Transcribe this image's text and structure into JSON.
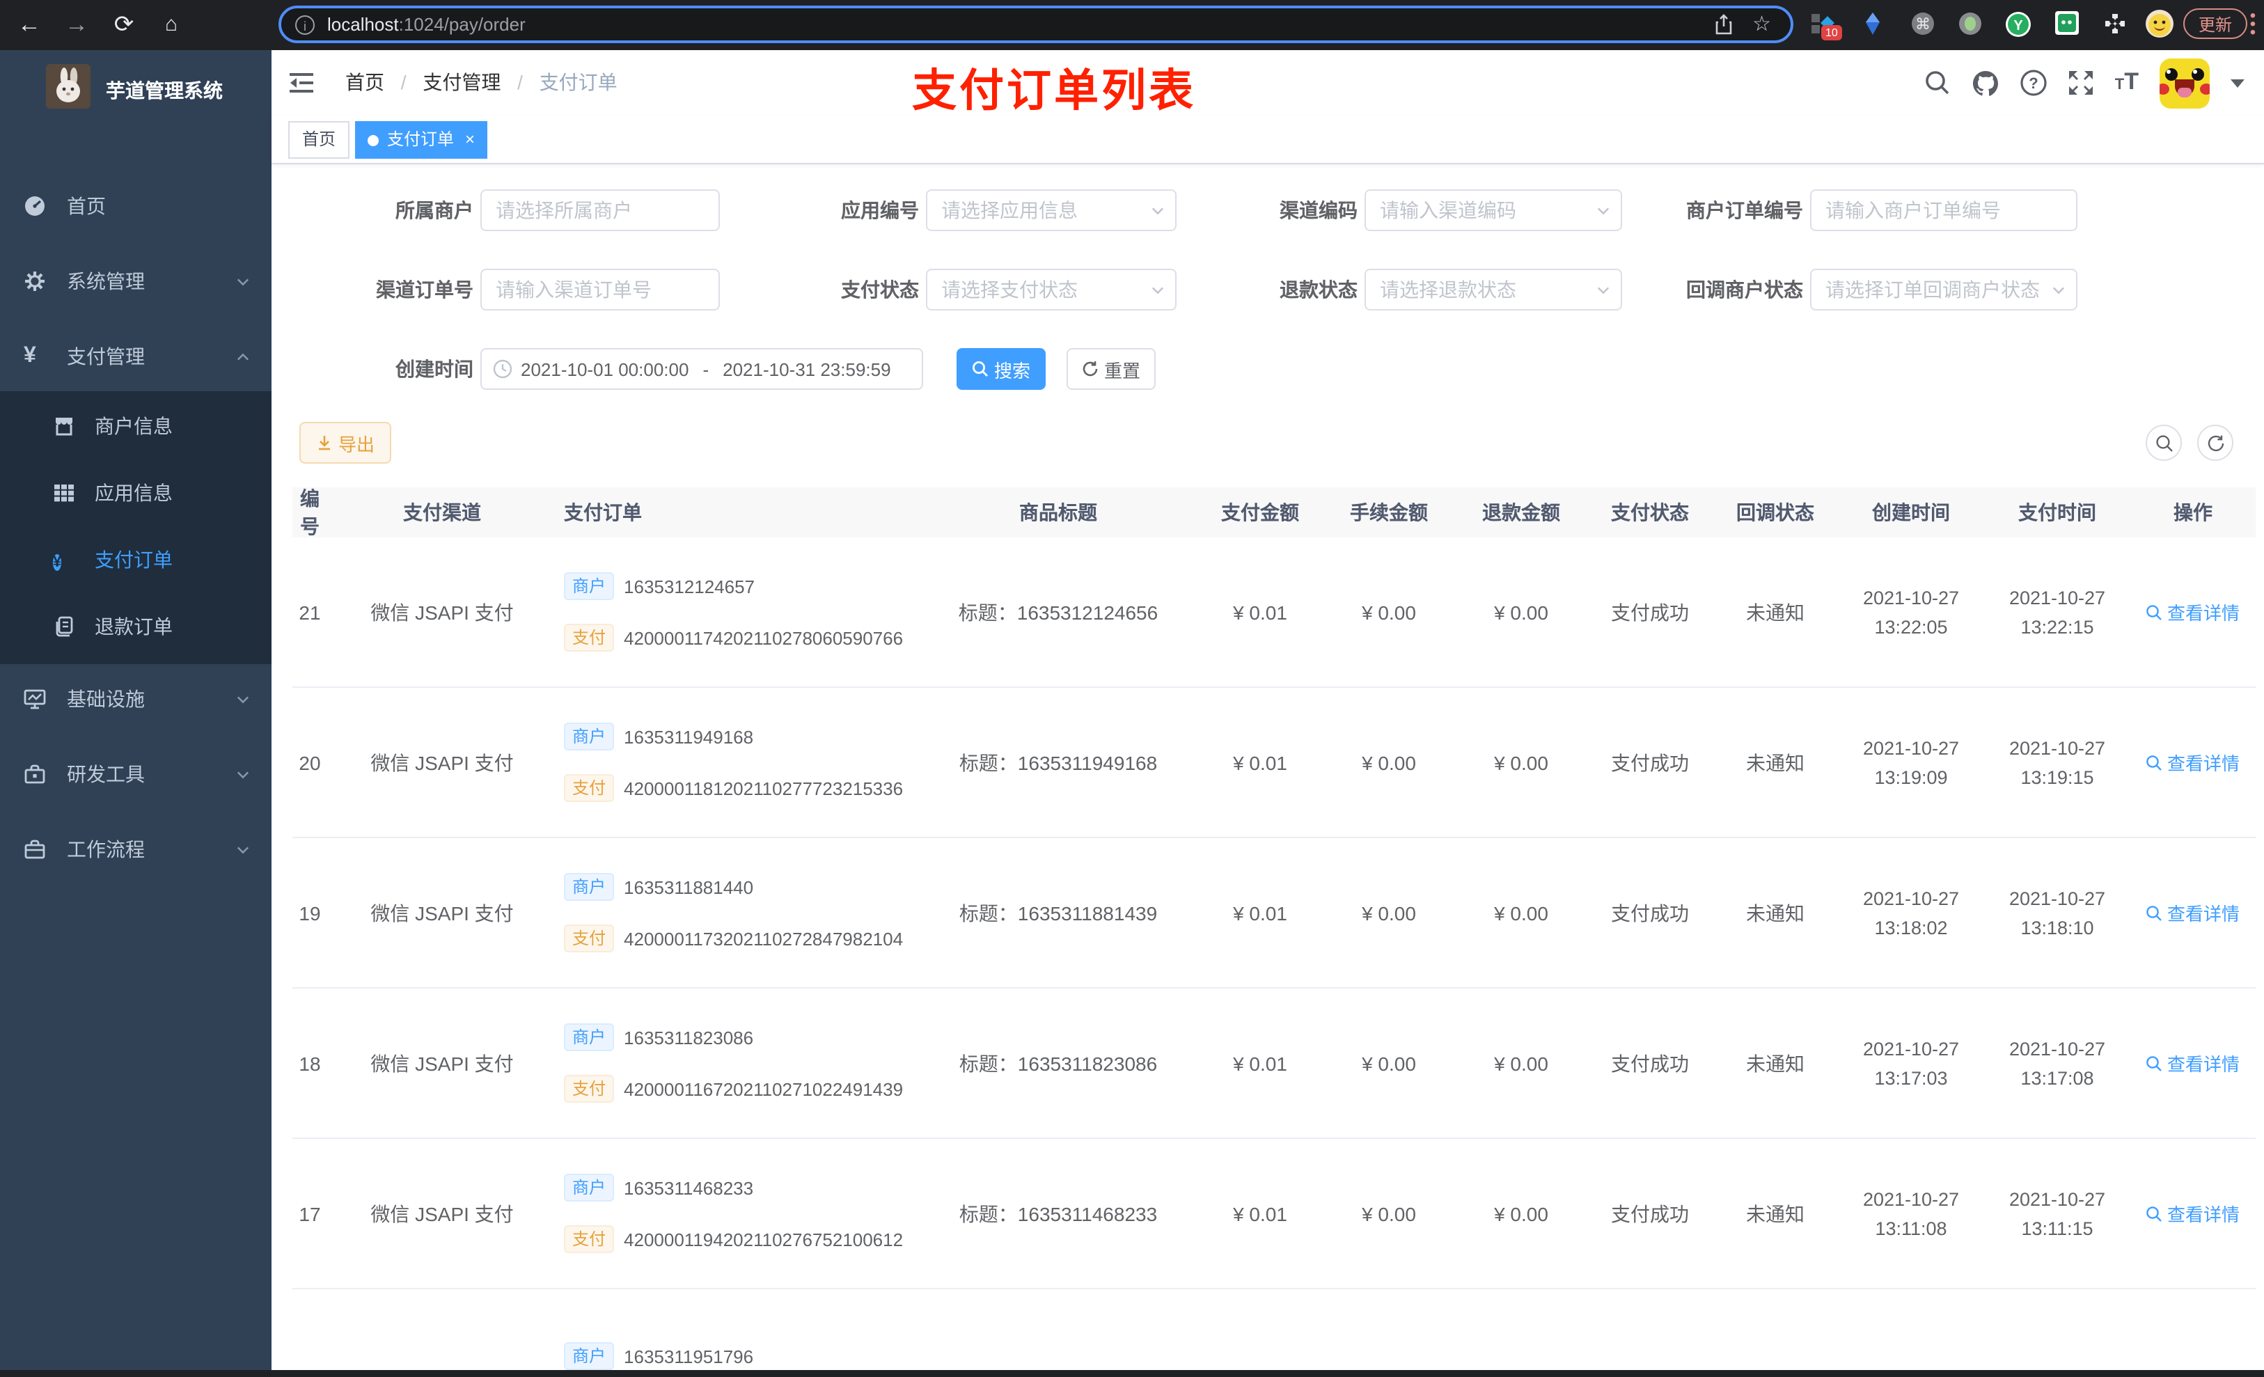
{
  "browser": {
    "url_host": "localhost",
    "url_path": ":1024/pay/order",
    "ext_badge": "10",
    "update_label": "更新"
  },
  "sidebar": {
    "title": "芋道管理系统",
    "home": "首页",
    "system": "系统管理",
    "payment": "支付管理",
    "merchant_info": "商户信息",
    "app_info": "应用信息",
    "pay_order": "支付订单",
    "refund_order": "退款订单",
    "infra": "基础设施",
    "devtools": "研发工具",
    "workflow": "工作流程"
  },
  "header": {
    "breadcrumb_1": "首页",
    "breadcrumb_2": "支付管理",
    "breadcrumb_3": "支付订单",
    "annotation": "支付订单列表",
    "annotation_color": "#ff2000"
  },
  "tabs": {
    "home": "首页",
    "active": "支付订单"
  },
  "filters": {
    "merchant": {
      "label": "所属商户",
      "placeholder": "请选择所属商户"
    },
    "app": {
      "label": "应用编号",
      "placeholder": "请选择应用信息"
    },
    "channel_code": {
      "label": "渠道编码",
      "placeholder": "请输入渠道编码"
    },
    "merchant_order_no": {
      "label": "商户订单编号",
      "placeholder": "请输入商户订单编号"
    },
    "channel_order_no": {
      "label": "渠道订单号",
      "placeholder": "请输入渠道订单号"
    },
    "pay_status": {
      "label": "支付状态",
      "placeholder": "请选择支付状态"
    },
    "refund_status": {
      "label": "退款状态",
      "placeholder": "请选择退款状态"
    },
    "notify_status": {
      "label": "回调商户状态",
      "placeholder": "请选择订单回调商户状态"
    },
    "create_time": {
      "label": "创建时间",
      "start": "2021-10-01 00:00:00",
      "sep": "-",
      "end": "2021-10-31 23:59:59"
    },
    "search_label": "搜索",
    "reset_label": "重置"
  },
  "toolbar": {
    "export_label": "导出"
  },
  "table": {
    "columns": [
      "编号",
      "支付渠道",
      "支付订单",
      "商品标题",
      "支付金额",
      "手续金额",
      "退款金额",
      "支付状态",
      "回调状态",
      "创建时间",
      "支付时间",
      "操作"
    ],
    "tag_merchant": "商户",
    "tag_pay": "支付",
    "action_label": "查看详情",
    "accent_color": "#409eff",
    "rows": [
      {
        "id": "21",
        "channel": "微信 JSAPI 支付",
        "merchant_no": "1635312124657",
        "pay_no": "4200001174202110278060590766",
        "title": "标题：1635312124656",
        "amount": "¥ 0.01",
        "fee": "¥ 0.00",
        "refund": "¥ 0.00",
        "status": "支付成功",
        "notify": "未通知",
        "created_date": "2021-10-27",
        "created_time": "13:22:05",
        "paid_date": "2021-10-27",
        "paid_time": "13:22:15"
      },
      {
        "id": "20",
        "channel": "微信 JSAPI 支付",
        "merchant_no": "1635311949168",
        "pay_no": "4200001181202110277723215336",
        "title": "标题：1635311949168",
        "amount": "¥ 0.01",
        "fee": "¥ 0.00",
        "refund": "¥ 0.00",
        "status": "支付成功",
        "notify": "未通知",
        "created_date": "2021-10-27",
        "created_time": "13:19:09",
        "paid_date": "2021-10-27",
        "paid_time": "13:19:15"
      },
      {
        "id": "19",
        "channel": "微信 JSAPI 支付",
        "merchant_no": "1635311881440",
        "pay_no": "4200001173202110272847982104",
        "title": "标题：1635311881439",
        "amount": "¥ 0.01",
        "fee": "¥ 0.00",
        "refund": "¥ 0.00",
        "status": "支付成功",
        "notify": "未通知",
        "created_date": "2021-10-27",
        "created_time": "13:18:02",
        "paid_date": "2021-10-27",
        "paid_time": "13:18:10"
      },
      {
        "id": "18",
        "channel": "微信 JSAPI 支付",
        "merchant_no": "1635311823086",
        "pay_no": "4200001167202110271022491439",
        "title": "标题：1635311823086",
        "amount": "¥ 0.01",
        "fee": "¥ 0.00",
        "refund": "¥ 0.00",
        "status": "支付成功",
        "notify": "未通知",
        "created_date": "2021-10-27",
        "created_time": "13:17:03",
        "paid_date": "2021-10-27",
        "paid_time": "13:17:08"
      },
      {
        "id": "17",
        "channel": "微信 JSAPI 支付",
        "merchant_no": "1635311468233",
        "pay_no": "4200001194202110276752100612",
        "title": "标题：1635311468233",
        "amount": "¥ 0.01",
        "fee": "¥ 0.00",
        "refund": "¥ 0.00",
        "status": "支付成功",
        "notify": "未通知",
        "created_date": "2021-10-27",
        "created_time": "13:11:08",
        "paid_date": "2021-10-27",
        "paid_time": "13:11:15"
      }
    ],
    "partial_row": {
      "merchant_no": "1635311951796"
    }
  }
}
